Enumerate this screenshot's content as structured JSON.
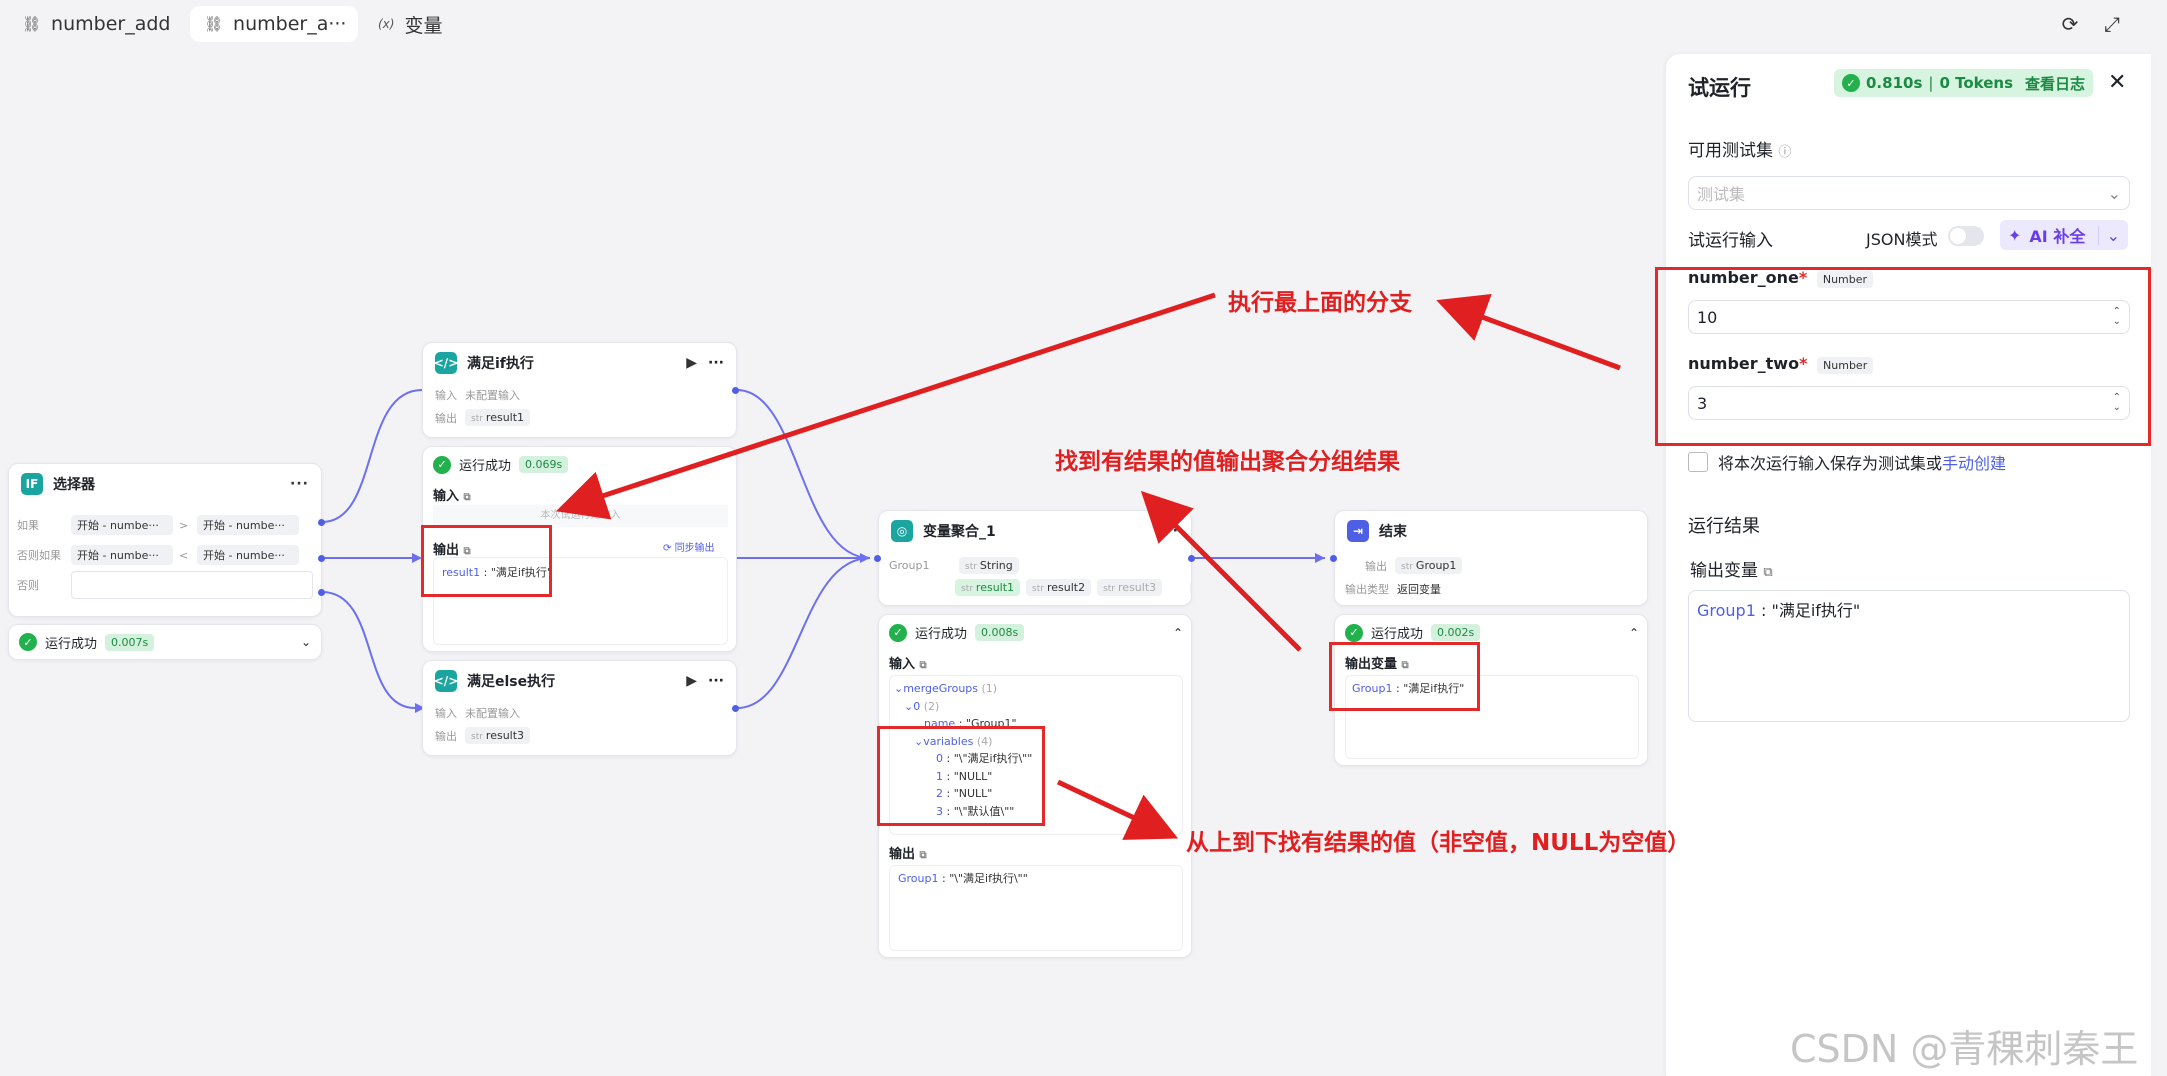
{
  "tabs": [
    {
      "label": "number_add",
      "icon": "workflow-icon"
    },
    {
      "label": "number_a···",
      "icon": "workflow-icon"
    },
    {
      "label": "变量",
      "icon": "variable-icon"
    }
  ],
  "tab_icon_var": "(x)",
  "toolbar": {
    "refresh_icon": "refresh-icon",
    "expand_icon": "expand-icon"
  },
  "colors": {
    "accent": "#4e5fe6",
    "success": "#23b14d",
    "annotation": "#e02020",
    "teal": "#1aa5a0"
  },
  "selector": {
    "title": "选择器",
    "icon_text": "IF",
    "rows": [
      {
        "label": "如果",
        "left": "开始 - numbe···",
        "op": ">",
        "right": "开始 - numbe···"
      },
      {
        "label": "否则如果",
        "left": "开始 - numbe···",
        "op": "<",
        "right": "开始 - numbe···"
      },
      {
        "label": "否则",
        "left": "",
        "op": "",
        "right": ""
      }
    ],
    "status": "运行成功",
    "time": "0.007s"
  },
  "if_node": {
    "title": "满足if执行",
    "input_label": "输入",
    "input_value": "未配置输入",
    "output_label": "输出",
    "output_type": "str",
    "output_value": "result1"
  },
  "if_result": {
    "status": "运行成功",
    "time": "0.069s",
    "input_title": "输入",
    "input_empty": "本次试运行无输入",
    "output_title": "输出",
    "sync": "同步输出",
    "output_line_key": "result1",
    "output_line_value": "\"满足if执行\""
  },
  "else_node": {
    "title": "满足else执行",
    "input_label": "输入",
    "input_value": "未配置输入",
    "output_label": "输出",
    "output_type": "str",
    "output_value": "result3"
  },
  "agg_node": {
    "title": "变量聚合_1",
    "group_label": "Group1",
    "type_tag": "String",
    "type_prefix": "str",
    "vars": [
      "result1",
      "result2",
      "result3"
    ],
    "more": "···"
  },
  "agg_result": {
    "status": "运行成功",
    "time": "0.008s",
    "input_title": "输入",
    "merge_key": "mergeGroups",
    "merge_count": "(1)",
    "idx0": "0",
    "idx0_count": "(2)",
    "name_key": "name",
    "name_val": "\"Group1\"",
    "vars_key": "variables",
    "vars_count": "(4)",
    "vars_lines": [
      {
        "k": "0",
        "v": "\"\\\"满足if执行\\\"\""
      },
      {
        "k": "1",
        "v": "\"NULL\""
      },
      {
        "k": "2",
        "v": "\"NULL\""
      },
      {
        "k": "3",
        "v": "\"\\\"默认值\\\"\""
      }
    ],
    "output_title": "输出",
    "output_key": "Group1",
    "output_val": "\"\\\"满足if执行\\\"\""
  },
  "end_node": {
    "title": "结束",
    "output_label": "输出",
    "output_type": "str",
    "output_value": "Group1",
    "type_label": "输出类型",
    "type_value": "返回变量"
  },
  "end_result": {
    "status": "运行成功",
    "time": "0.002s",
    "title": "输出变量",
    "line_key": "Group1",
    "line_val": "\"满足if执行\""
  },
  "panel": {
    "title": "试运行",
    "status_time": "0.810s",
    "status_sep": "|",
    "tokens": "0 Tokens",
    "view_log": "查看日志",
    "testset_label": "可用测试集",
    "testset_placeholder": "测试集",
    "run_input_label": "试运行输入",
    "json_mode": "JSON模式",
    "ai_fill": "AI 补全",
    "fields": [
      {
        "name": "number_one",
        "required": "*",
        "type": "Number",
        "value": "10"
      },
      {
        "name": "number_two",
        "required": "*",
        "type": "Number",
        "value": "3"
      }
    ],
    "save_label": "将本次运行输入保存为测试集或",
    "save_link": "手动创建",
    "result_title": "运行结果",
    "output_var_title": "输出变量",
    "output_key": "Group1",
    "output_val": "\"满足if执行\""
  },
  "annotations": {
    "a1": "执行最上面的分支",
    "a2": "找到有结果的值输出聚合分组结果",
    "a3": "从上到下找有结果的值（非空值，NULL为空值）"
  },
  "watermark": "CSDN @青稞刺秦王"
}
